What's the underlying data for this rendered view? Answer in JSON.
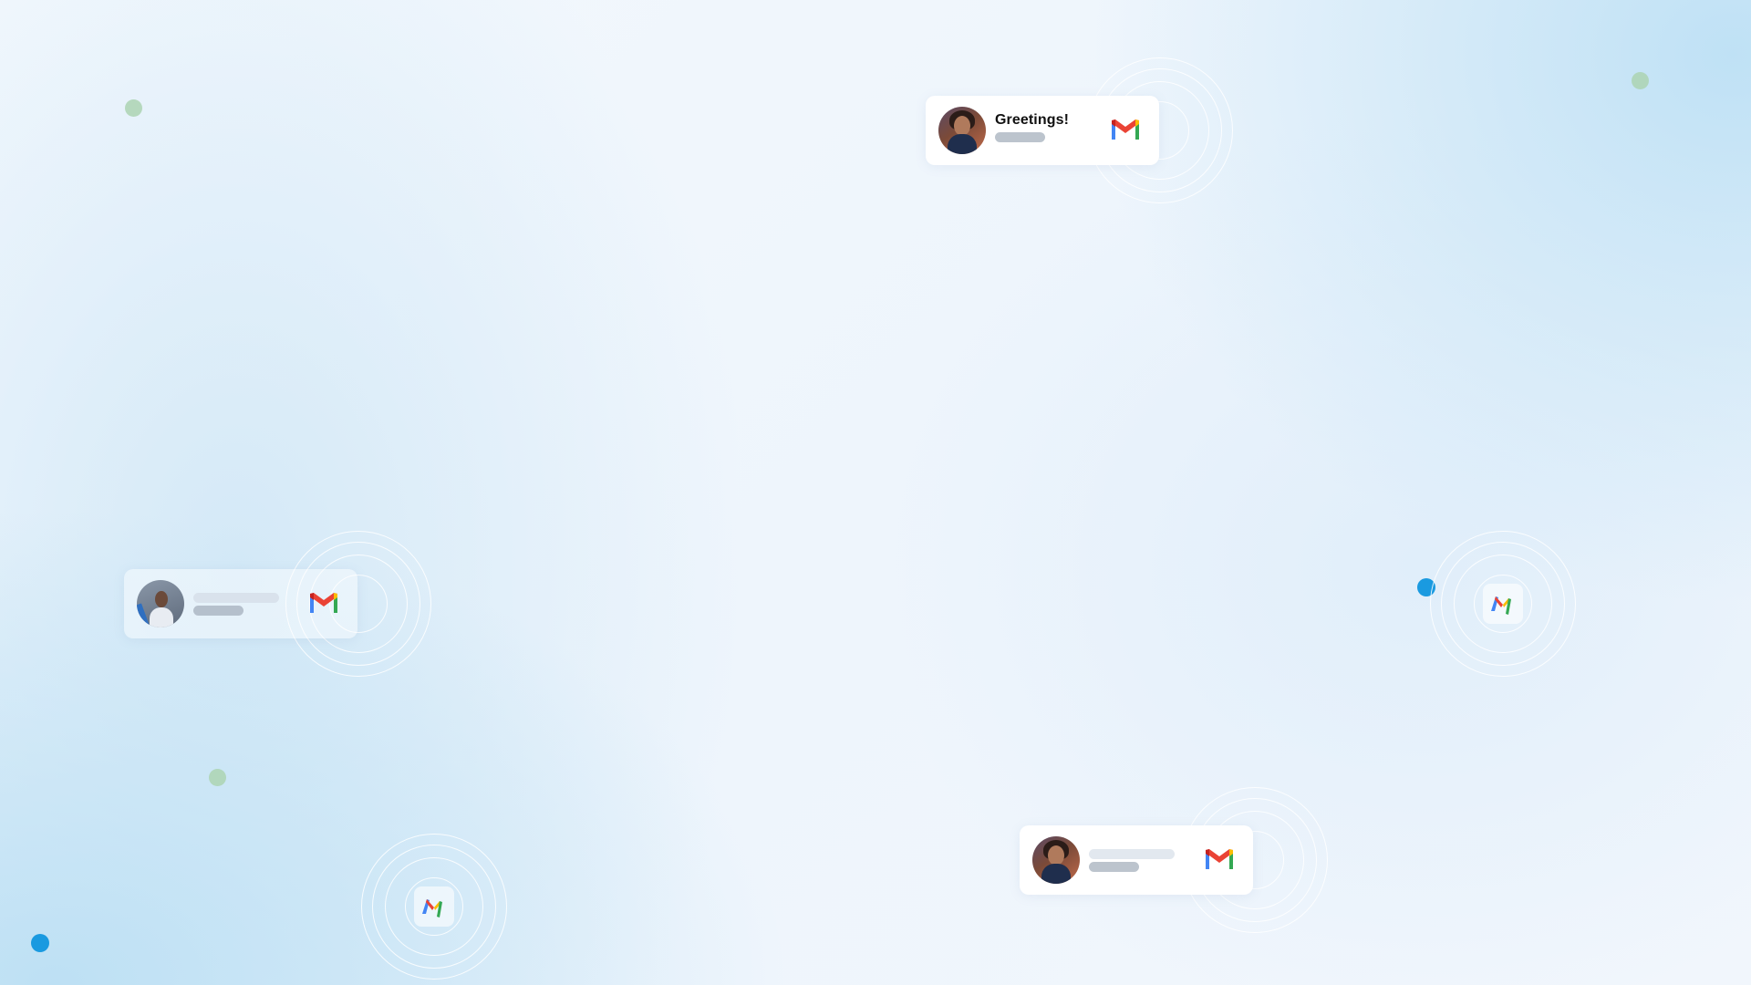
{
  "notifications": [
    {
      "title": "Greetings!"
    }
  ],
  "icons": {
    "mail": "gmail-icon",
    "badge": "gmail-badge-icon"
  },
  "colors": {
    "gmail_red": "#EA4335",
    "gmail_blue": "#4285F4",
    "gmail_green": "#34A853",
    "gmail_yellow": "#FBBC04",
    "dot_blue": "#1A9AE0",
    "dot_green": "#ACD3B2"
  }
}
